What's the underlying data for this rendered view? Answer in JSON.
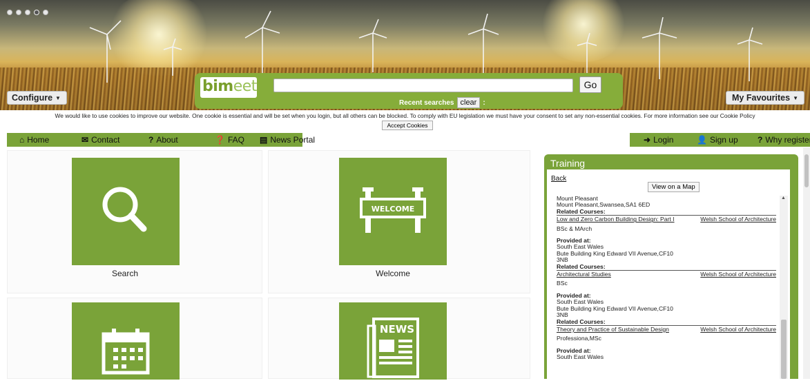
{
  "banner": {
    "configure_label": "Configure",
    "favourites_label": "My Favourites",
    "logo_part1": "bim",
    "logo_part2": "eet",
    "search_value": "",
    "go_label": "Go",
    "recent_label": "Recent searches",
    "clear_label": "clear",
    "colon": ":"
  },
  "cookie": {
    "text": "We would like to use cookies to improve our website. One cookie is essential and will be set when you login, but all others can be blocked. To comply with EU legislation we must have your consent to set any non-essential cookies. For more information see our Cookie Policy",
    "accept_label": "Accept Cookies"
  },
  "nav": {
    "home": "Home",
    "contact": "Contact",
    "about": "About",
    "faq": "FAQ",
    "news": "News Portal",
    "login": "Login",
    "signup": "Sign up",
    "why": "Why register"
  },
  "tiles": {
    "search": "Search",
    "welcome": "Welcome",
    "welcome_sign": "WELCOME",
    "news_sign": "NEWS"
  },
  "training": {
    "title": "Training",
    "back": "Back",
    "map_btn": "View on a Map",
    "entries": [
      {
        "place": "Mount Pleasant",
        "address": "Mount Pleasant,Swansea,SA1 6ED",
        "related": "Related Courses:",
        "course": "Low and Zero Carbon Building Design: Part I",
        "school": "Welsh School of Architecture",
        "qual": "BSc & MArch"
      },
      {
        "provided": "Provided at:",
        "region": "South East Wales",
        "address1": "Bute Building King Edward VII Avenue,CF10",
        "address2": "3NB",
        "related": "Related Courses:",
        "course": "Architectural Studies",
        "school": "Welsh School of Architecture",
        "qual": "BSc"
      },
      {
        "provided": "Provided at:",
        "region": "South East Wales",
        "address1": "Bute Building King Edward VII Avenue,CF10",
        "address2": "3NB",
        "related": "Related Courses:",
        "course": "Theory and Practice of Sustainable Design",
        "school": "Welsh School of Architecture",
        "qual": "Professiona,MSc"
      },
      {
        "provided": "Provided at:",
        "region": "South East Wales"
      }
    ]
  }
}
